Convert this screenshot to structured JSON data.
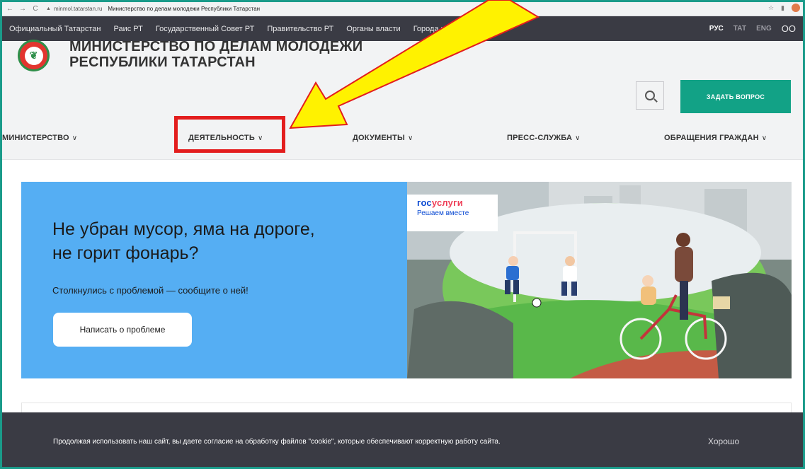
{
  "browser": {
    "back_icon": "←",
    "forward_icon": "→",
    "reload_icon": "C",
    "lock_icon": "lock-icon",
    "url": "minmol.tatarstan.ru",
    "tab_title": "Министерство по делам молодежи Республики Татарстан"
  },
  "topnav": {
    "links": [
      "Официальный Татарстан",
      "Раис РТ",
      "Государственный Совет РТ",
      "Правительство РТ",
      "Органы власти",
      "Города и районы РТ"
    ],
    "lang": [
      "РУС",
      "ТАТ",
      "ENG"
    ],
    "accessibility_glyph": "OO"
  },
  "header": {
    "title_line1": "МИНИСТЕРСТВО ПО ДЕЛАМ МОЛОДЕЖИ",
    "title_line2": "РЕСПУБЛИКИ ТАТАРСТАН",
    "ask_button": "ЗАДАТЬ ВОПРОС",
    "search_icon": "search-icon"
  },
  "mainnav": {
    "items": [
      "МИНИСТЕРСТВО",
      "ДЕЯТЕЛЬНОСТЬ",
      "ДОКУМЕНТЫ",
      "ПРЕСС-СЛУЖБА",
      "ОБРАЩЕНИЯ ГРАЖДАН"
    ],
    "chevron": "∨"
  },
  "banner": {
    "title": "Не убран мусор, яма на дороге, не горит фонарь?",
    "subtitle": "Столкнулись с проблемой — сообщите о ней!",
    "button": "Написать о проблеме",
    "gos_logo_part1": "гос",
    "gos_logo_part2": "услуги",
    "gos_tagline": "Решаем вместе"
  },
  "cookie": {
    "text": "Продолжая использовать наш сайт, вы даете согласие на обработку файлов \"cookie\", которые обеспечивают корректную работу сайта.",
    "button": "Хорошо"
  },
  "colors": {
    "accent": "#12a286",
    "topnav_bg": "#3a3b44",
    "banner_blue": "#55aef3",
    "highlight": "#e31d1d",
    "arrow": "#fff200"
  }
}
